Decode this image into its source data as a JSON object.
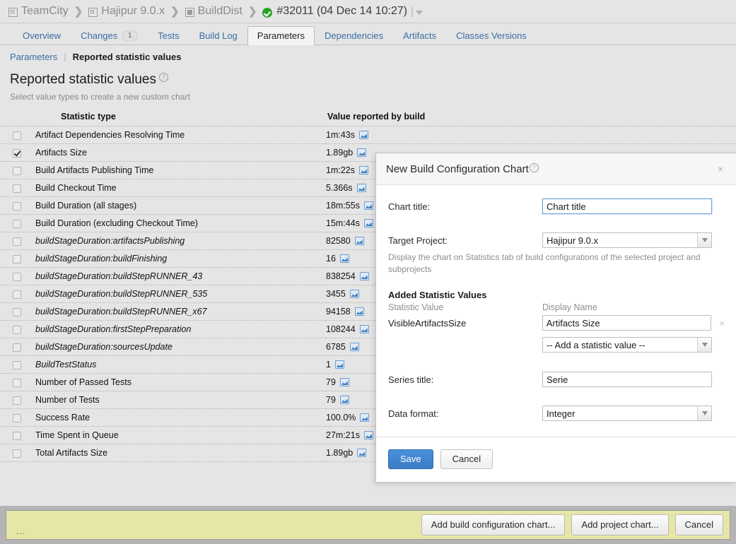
{
  "breadcrumb": {
    "items": [
      {
        "label": "TeamCity",
        "icon": "project-icon"
      },
      {
        "label": "Hajipur 9.0.x",
        "icon": "project-icon"
      },
      {
        "label": "BuildDist",
        "icon": "build-type-icon"
      }
    ],
    "build": {
      "label": "#32011 (04 Dec 14 10:27)",
      "status_icon": "success-check-icon"
    },
    "separator": "❯"
  },
  "tabs": [
    {
      "label": "Overview",
      "badge": null,
      "active": false
    },
    {
      "label": "Changes",
      "badge": "1",
      "active": false
    },
    {
      "label": "Tests",
      "badge": null,
      "active": false
    },
    {
      "label": "Build Log",
      "badge": null,
      "active": false
    },
    {
      "label": "Parameters",
      "badge": null,
      "active": true
    },
    {
      "label": "Dependencies",
      "badge": null,
      "active": false
    },
    {
      "label": "Artifacts",
      "badge": null,
      "active": false
    },
    {
      "label": "Classes Versions",
      "badge": null,
      "active": false
    }
  ],
  "subnav": {
    "link": "Parameters",
    "separator": "|",
    "current": "Reported statistic values"
  },
  "page": {
    "title": "Reported statistic values",
    "help_glyph": "?",
    "subtitle": "Select value types to create a new custom chart"
  },
  "table": {
    "headers": {
      "name": "Statistic type",
      "value": "Value reported by build"
    },
    "rows": [
      {
        "name": "Artifact Dependencies Resolving Time",
        "value": "1m:43s",
        "checked": false,
        "italic": false
      },
      {
        "name": "Artifacts Size",
        "value": "1.89gb",
        "checked": true,
        "italic": false
      },
      {
        "name": "Build Artifacts Publishing Time",
        "value": "1m:22s",
        "checked": false,
        "italic": false
      },
      {
        "name": "Build Checkout Time",
        "value": "5.366s",
        "checked": false,
        "italic": false
      },
      {
        "name": "Build Duration (all stages)",
        "value": "18m:55s",
        "checked": false,
        "italic": false
      },
      {
        "name": "Build Duration (excluding Checkout Time)",
        "value": "15m:44s",
        "checked": false,
        "italic": false
      },
      {
        "name": "buildStageDuration:artifactsPublishing",
        "value": "82580",
        "checked": false,
        "italic": true
      },
      {
        "name": "buildStageDuration:buildFinishing",
        "value": "16",
        "checked": false,
        "italic": true
      },
      {
        "name": "buildStageDuration:buildStepRUNNER_43",
        "value": "838254",
        "checked": false,
        "italic": true
      },
      {
        "name": "buildStageDuration:buildStepRUNNER_535",
        "value": "3455",
        "checked": false,
        "italic": true
      },
      {
        "name": "buildStageDuration:buildStepRUNNER_x67",
        "value": "94158",
        "checked": false,
        "italic": true
      },
      {
        "name": "buildStageDuration:firstStepPreparation",
        "value": "108244",
        "checked": false,
        "italic": true
      },
      {
        "name": "buildStageDuration:sourcesUpdate",
        "value": "6785",
        "checked": false,
        "italic": true
      },
      {
        "name": "BuildTestStatus",
        "value": "1",
        "checked": false,
        "italic": true
      },
      {
        "name": "Number of Passed Tests",
        "value": "79",
        "checked": false,
        "italic": false
      },
      {
        "name": "Number of Tests",
        "value": "79",
        "checked": false,
        "italic": false
      },
      {
        "name": "Success Rate",
        "value": "100.0%",
        "checked": false,
        "italic": false
      },
      {
        "name": "Time Spent in Queue",
        "value": "27m:21s",
        "checked": false,
        "italic": false
      },
      {
        "name": "Total Artifacts Size",
        "value": "1.89gb",
        "checked": false,
        "italic": false
      }
    ]
  },
  "modal": {
    "title": "New Build Configuration Chart",
    "help_glyph": "?",
    "close_glyph": "×",
    "chart_title": {
      "label": "Chart title:",
      "value": "Chart title"
    },
    "target_project": {
      "label": "Target Project:",
      "value": "Hajipur 9.0.x",
      "hint": "Display the chart on Statistics tab of build configurations of the selected project and subprojects"
    },
    "added_statistic_values": {
      "section_title": "Added Statistic Values",
      "col_statistic_value": "Statistic Value",
      "col_display_name": "Display Name",
      "rows": [
        {
          "statistic_value": "VisibleArtifactsSize",
          "display_name": "Artifacts Size",
          "remove_glyph": "×"
        }
      ],
      "add_placeholder": "-- Add a statistic value --"
    },
    "series_title": {
      "label": "Series title:",
      "value": "Serie"
    },
    "data_format": {
      "label": "Data format:",
      "value": "Integer"
    },
    "save_label": "Save",
    "cancel_label": "Cancel"
  },
  "bottom_bar": {
    "dots": "...",
    "buttons": [
      {
        "label": "Add build configuration chart..."
      },
      {
        "label": "Add project chart..."
      },
      {
        "label": "Cancel"
      }
    ]
  },
  "colors": {
    "accent": "#3a7cc4",
    "success": "#2aa028",
    "bottom_bar": "#e6e6a8",
    "page_bg": "#e5e5e5"
  }
}
